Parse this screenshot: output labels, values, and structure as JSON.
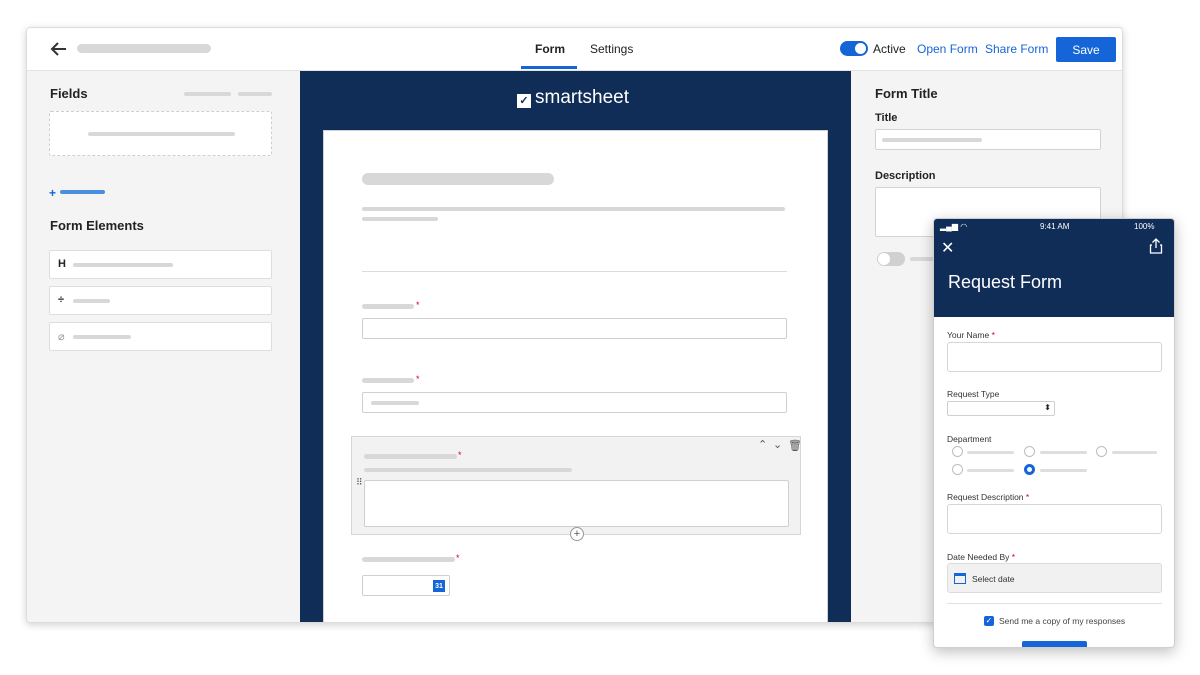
{
  "header": {
    "tabs": [
      {
        "label": "Form"
      },
      {
        "label": "Settings"
      }
    ],
    "active_label": "Active",
    "open_form": "Open Form",
    "share_form": "Share Form",
    "save": "Save"
  },
  "left": {
    "fields_title": "Fields",
    "form_elements_title": "Form Elements",
    "elements": [
      {
        "icon": "H"
      },
      {
        "icon": "÷"
      },
      {
        "icon": "⌀"
      }
    ]
  },
  "center": {
    "logo": "smartsheet"
  },
  "right": {
    "form_title": "Form Title",
    "title_label": "Title",
    "description_label": "Description"
  },
  "phone": {
    "time": "9:41 AM",
    "battery": "100%",
    "title": "Request Form",
    "your_name": "Your Name",
    "request_type": "Request Type",
    "department": "Department",
    "request_description": "Request Description",
    "date_needed_by": "Date Needed By",
    "date_placeholder": "Select date",
    "copy_label": "Send me a copy of my responses",
    "required_mark": "*"
  },
  "colors": {
    "accent": "#1565d8",
    "navy": "#0f2d57",
    "required": "#d0021b"
  }
}
